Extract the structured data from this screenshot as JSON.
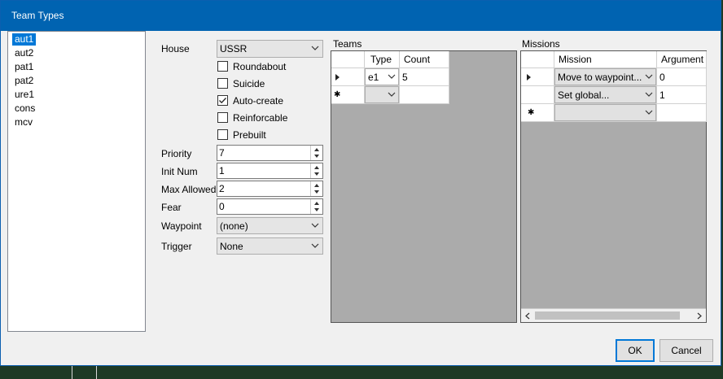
{
  "window": {
    "title": "Team Types"
  },
  "team_list": [
    "aut1",
    "aut2",
    "pat1",
    "pat2",
    "ure1",
    "cons",
    "mcv"
  ],
  "team_list_selected": "aut1",
  "form": {
    "house_label": "House",
    "house_value": "USSR",
    "checkboxes": [
      {
        "label": "Roundabout",
        "checked": false
      },
      {
        "label": "Suicide",
        "checked": false
      },
      {
        "label": "Auto-create",
        "checked": true
      },
      {
        "label": "Reinforcable",
        "checked": false
      },
      {
        "label": "Prebuilt",
        "checked": false
      }
    ],
    "priority_label": "Priority",
    "priority_value": "7",
    "init_num_label": "Init Num",
    "init_num_value": "1",
    "max_allowed_label": "Max Allowed",
    "max_allowed_value": "2",
    "fear_label": "Fear",
    "fear_value": "0",
    "waypoint_label": "Waypoint",
    "waypoint_value": "(none)",
    "trigger_label": "Trigger",
    "trigger_value": "None"
  },
  "teams": {
    "title": "Teams",
    "headers": [
      "Type",
      "Count"
    ],
    "rows": [
      {
        "type": "e1",
        "count": "5"
      },
      {
        "type": "",
        "count": ""
      }
    ]
  },
  "missions": {
    "title": "Missions",
    "headers": [
      "Mission",
      "Argument"
    ],
    "rows": [
      {
        "mission": "Move to waypoint...",
        "argument": "0"
      },
      {
        "mission": "Set global...",
        "argument": "1"
      },
      {
        "mission": "",
        "argument": ""
      }
    ]
  },
  "buttons": {
    "ok": "OK",
    "cancel": "Cancel"
  },
  "icons": {
    "row_current": "triangle-right-icon",
    "row_new": "asterisk-icon",
    "dropdown": "chevron-down-icon"
  }
}
